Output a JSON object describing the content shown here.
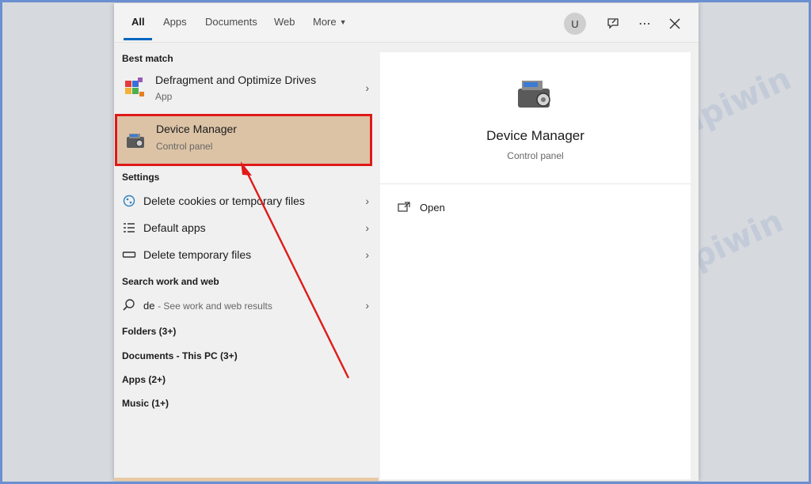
{
  "tabs": [
    {
      "label": "All",
      "active": true
    },
    {
      "label": "Apps"
    },
    {
      "label": "Documents"
    },
    {
      "label": "Web"
    },
    {
      "label": "More"
    }
  ],
  "user": {
    "initial": "U"
  },
  "sections": {
    "best_match": "Best match",
    "settings": "Settings",
    "search_web": "Search work and web",
    "folders": "Folders (3+)",
    "documents": "Documents - This PC (3+)",
    "apps": "Apps (2+)",
    "music": "Music (1+)"
  },
  "results": {
    "defrag": {
      "title": "Defragment and Optimize Drives",
      "sub": "App"
    },
    "device_manager": {
      "title": "Device Manager",
      "sub": "Control panel"
    }
  },
  "settings_items": [
    {
      "label": "Delete cookies or temporary files"
    },
    {
      "label": "Default apps"
    },
    {
      "label": "Delete temporary files"
    }
  ],
  "web": {
    "query": "de",
    "hint": "- See work and web results"
  },
  "preview": {
    "title": "Device Manager",
    "sub": "Control panel",
    "action": "Open"
  },
  "watermark": "kompiwin",
  "colors": {
    "highlight": "#dcc3a6",
    "annotation": "#e01919",
    "accent": "#0067c0"
  }
}
